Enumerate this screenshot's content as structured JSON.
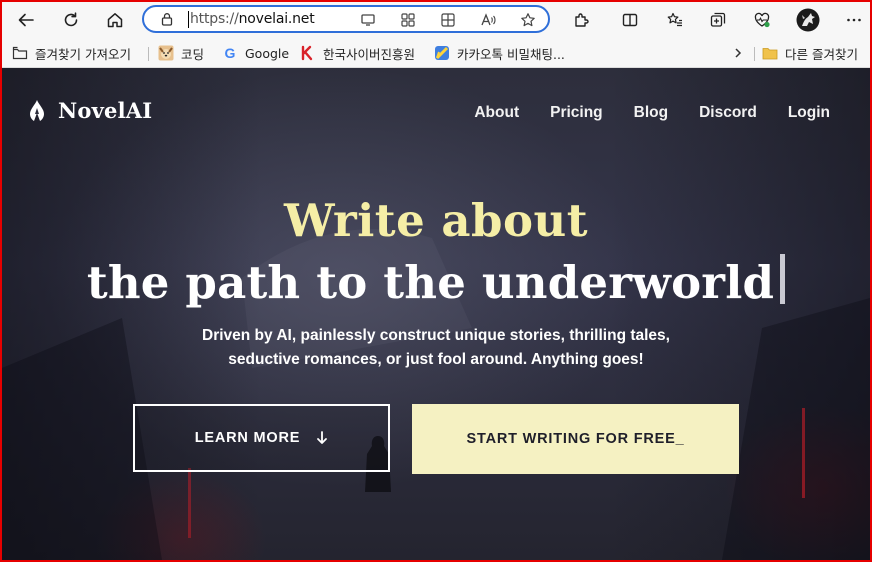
{
  "browser": {
    "url_protocol": "https://",
    "url_host": "novelai.net"
  },
  "favorites": {
    "import": "즐겨찾기 가져오기",
    "items": [
      {
        "label": "코딩"
      },
      {
        "label": "Google"
      },
      {
        "label": "한국사이버진흥원"
      },
      {
        "label": "카카오톡 비밀채팅..."
      }
    ],
    "other": "다른 즐겨찾기"
  },
  "site": {
    "logo": "NovelAI",
    "nav": [
      "About",
      "Pricing",
      "Blog",
      "Discord",
      "Login"
    ],
    "hero_line1": "Write about",
    "hero_line2": "the path to the underworld",
    "subtitle_line1": "Driven by AI, painlessly construct unique stories, thrilling tales,",
    "subtitle_line2": "seductive romances, or just fool around. Anything goes!",
    "learn_more": "LEARN MORE",
    "start_writing": "START WRITING FOR FREE_"
  },
  "colors": {
    "hero_accent": "#f5eea6",
    "cta_background": "#f5f1c2",
    "address_focus": "#2f6fd9",
    "window_border": "#e60000"
  }
}
